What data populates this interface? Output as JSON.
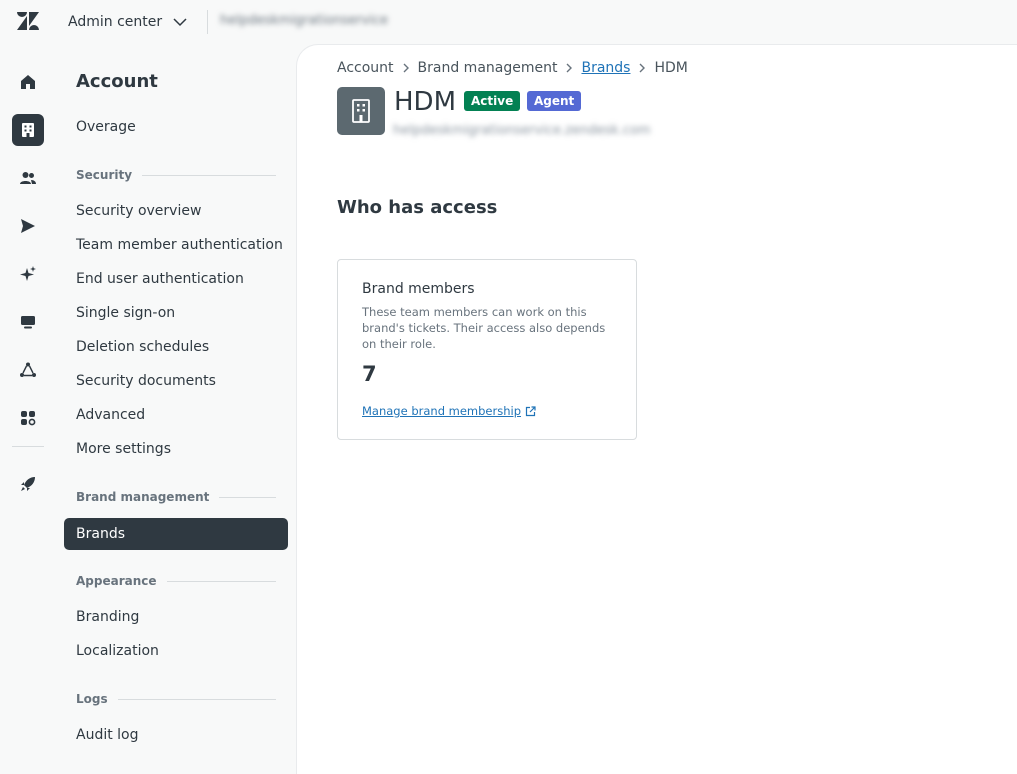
{
  "topbar": {
    "product_name": "Admin center",
    "subdomain": "helpdeskmigrationservice"
  },
  "rail": {
    "items": [
      {
        "icon": "home-icon"
      },
      {
        "icon": "account-building-icon",
        "active": true
      },
      {
        "icon": "people-icon"
      },
      {
        "icon": "channels-send-icon"
      },
      {
        "icon": "ai-sparkle-icon"
      },
      {
        "icon": "workspaces-icon"
      },
      {
        "icon": "objects-rules-icon"
      },
      {
        "icon": "apps-integrations-icon"
      },
      {
        "icon": "rocket-icon"
      }
    ]
  },
  "sidenav": {
    "title": "Account",
    "overage": "Overage",
    "security": {
      "heading": "Security",
      "items": [
        "Security overview",
        "Team member authentication",
        "End user authentication",
        "Single sign-on",
        "Deletion schedules",
        "Security documents",
        "Advanced",
        "More settings"
      ]
    },
    "brand_management": {
      "heading": "Brand management",
      "active_item": "Brands"
    },
    "appearance": {
      "heading": "Appearance",
      "items": [
        "Branding",
        "Localization"
      ]
    },
    "logs": {
      "heading": "Logs",
      "items": [
        "Audit log"
      ]
    }
  },
  "breadcrumb": {
    "items": [
      "Account",
      "Brand management",
      "Brands",
      "HDM"
    ]
  },
  "brand": {
    "name": "HDM",
    "status_badge": "Active",
    "role_badge": "Agent",
    "url": "helpdeskmigrationservice.zendesk.com",
    "colors": {
      "active": "#038153",
      "agent": "#5469d4"
    }
  },
  "access": {
    "heading": "Who has access",
    "card": {
      "title": "Brand members",
      "description": "These team members can work on this brand's tickets. Their access also depends on their role.",
      "count": "7",
      "link": "Manage brand membership"
    }
  }
}
